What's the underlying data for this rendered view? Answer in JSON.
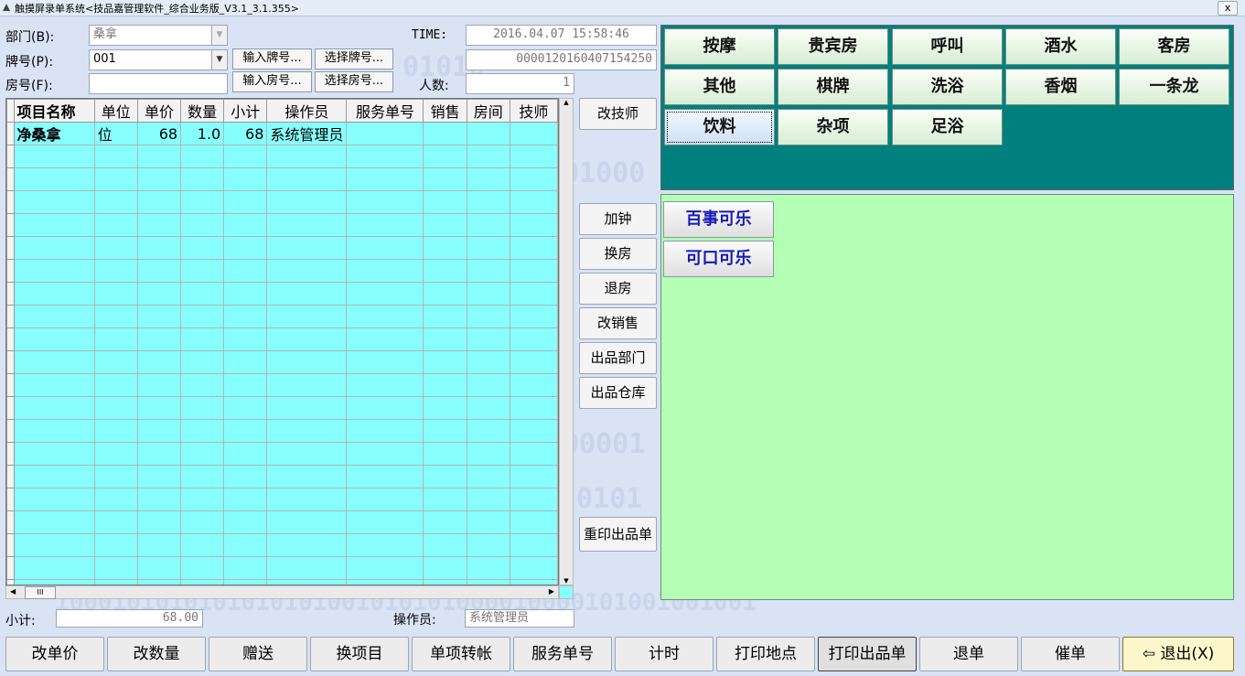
{
  "window": {
    "title": "触摸屏录单系统<技品嘉管理软件_综合业务版_V3.1_3.1.355>",
    "close_glyph": "x"
  },
  "watermark": {
    "lines": [
      "01010",
      "01000",
      "00001",
      "0101",
      "1000101010101010101001010101000010000101001001001"
    ]
  },
  "form": {
    "dept_label": "部门(B):",
    "dept_value": "桑拿",
    "card_label": "牌号(P):",
    "card_value": "001",
    "room_label": "房号(F):",
    "room_value": "",
    "input_card_btn": "输入牌号...",
    "select_card_btn": "选择牌号...",
    "input_room_btn": "输入房号...",
    "select_room_btn": "选择房号...",
    "time_label": "TIME:",
    "time_value": "2016.04.07 15:58:46",
    "serial_value": "0000120160407154250",
    "people_label": "人数:",
    "people_value": "1"
  },
  "grid": {
    "columns": [
      "项目名称",
      "单位",
      "单价",
      "数量",
      "小计",
      "操作员",
      "服务单号",
      "销售",
      "房间",
      "技师"
    ],
    "rows": [
      [
        "净桑拿",
        "位",
        "68",
        "1.0",
        "68",
        "系统管理员",
        "",
        "",
        "",
        ""
      ]
    ],
    "scroll_left": "◀",
    "scroll_right": "▶",
    "scroll_up": "▲",
    "scroll_down": "▼",
    "scroll_thumb": "III"
  },
  "middle_buttons": {
    "change_tech": "改技师",
    "add_clock": "加钟",
    "change_room": "换房",
    "checkout_room": "退房",
    "change_sales": "改销售",
    "out_dept": "出品部门",
    "out_store": "出品仓库",
    "reprint": "重印出品单"
  },
  "categories": [
    [
      "按摩",
      "贵宾房",
      "呼叫",
      "酒水",
      "客房"
    ],
    [
      "其他",
      "棋牌",
      "洗浴",
      "香烟",
      "一条龙"
    ],
    [
      "饮料",
      "杂项",
      "足浴"
    ]
  ],
  "selected_category": "饮料",
  "products": [
    "百事可乐",
    "可口可乐"
  ],
  "footer": {
    "subtotal_label": "小计:",
    "subtotal_value": "68.00",
    "operator_label": "操作员:",
    "operator_value": "系统管理员"
  },
  "bottom_buttons": [
    "改单价",
    "改数量",
    "赠送",
    "换项目",
    "单项转帐",
    "服务单号",
    "计时",
    "打印地点",
    "打印出品单",
    "退单",
    "催单"
  ],
  "exit_button": {
    "icon": "⇦",
    "label": "退出(X)"
  },
  "colors": {
    "grid_bg": "#88ffff",
    "category_panel": "#007f7f",
    "product_panel": "#b3ffb3",
    "product_text": "#1a1ab5"
  }
}
